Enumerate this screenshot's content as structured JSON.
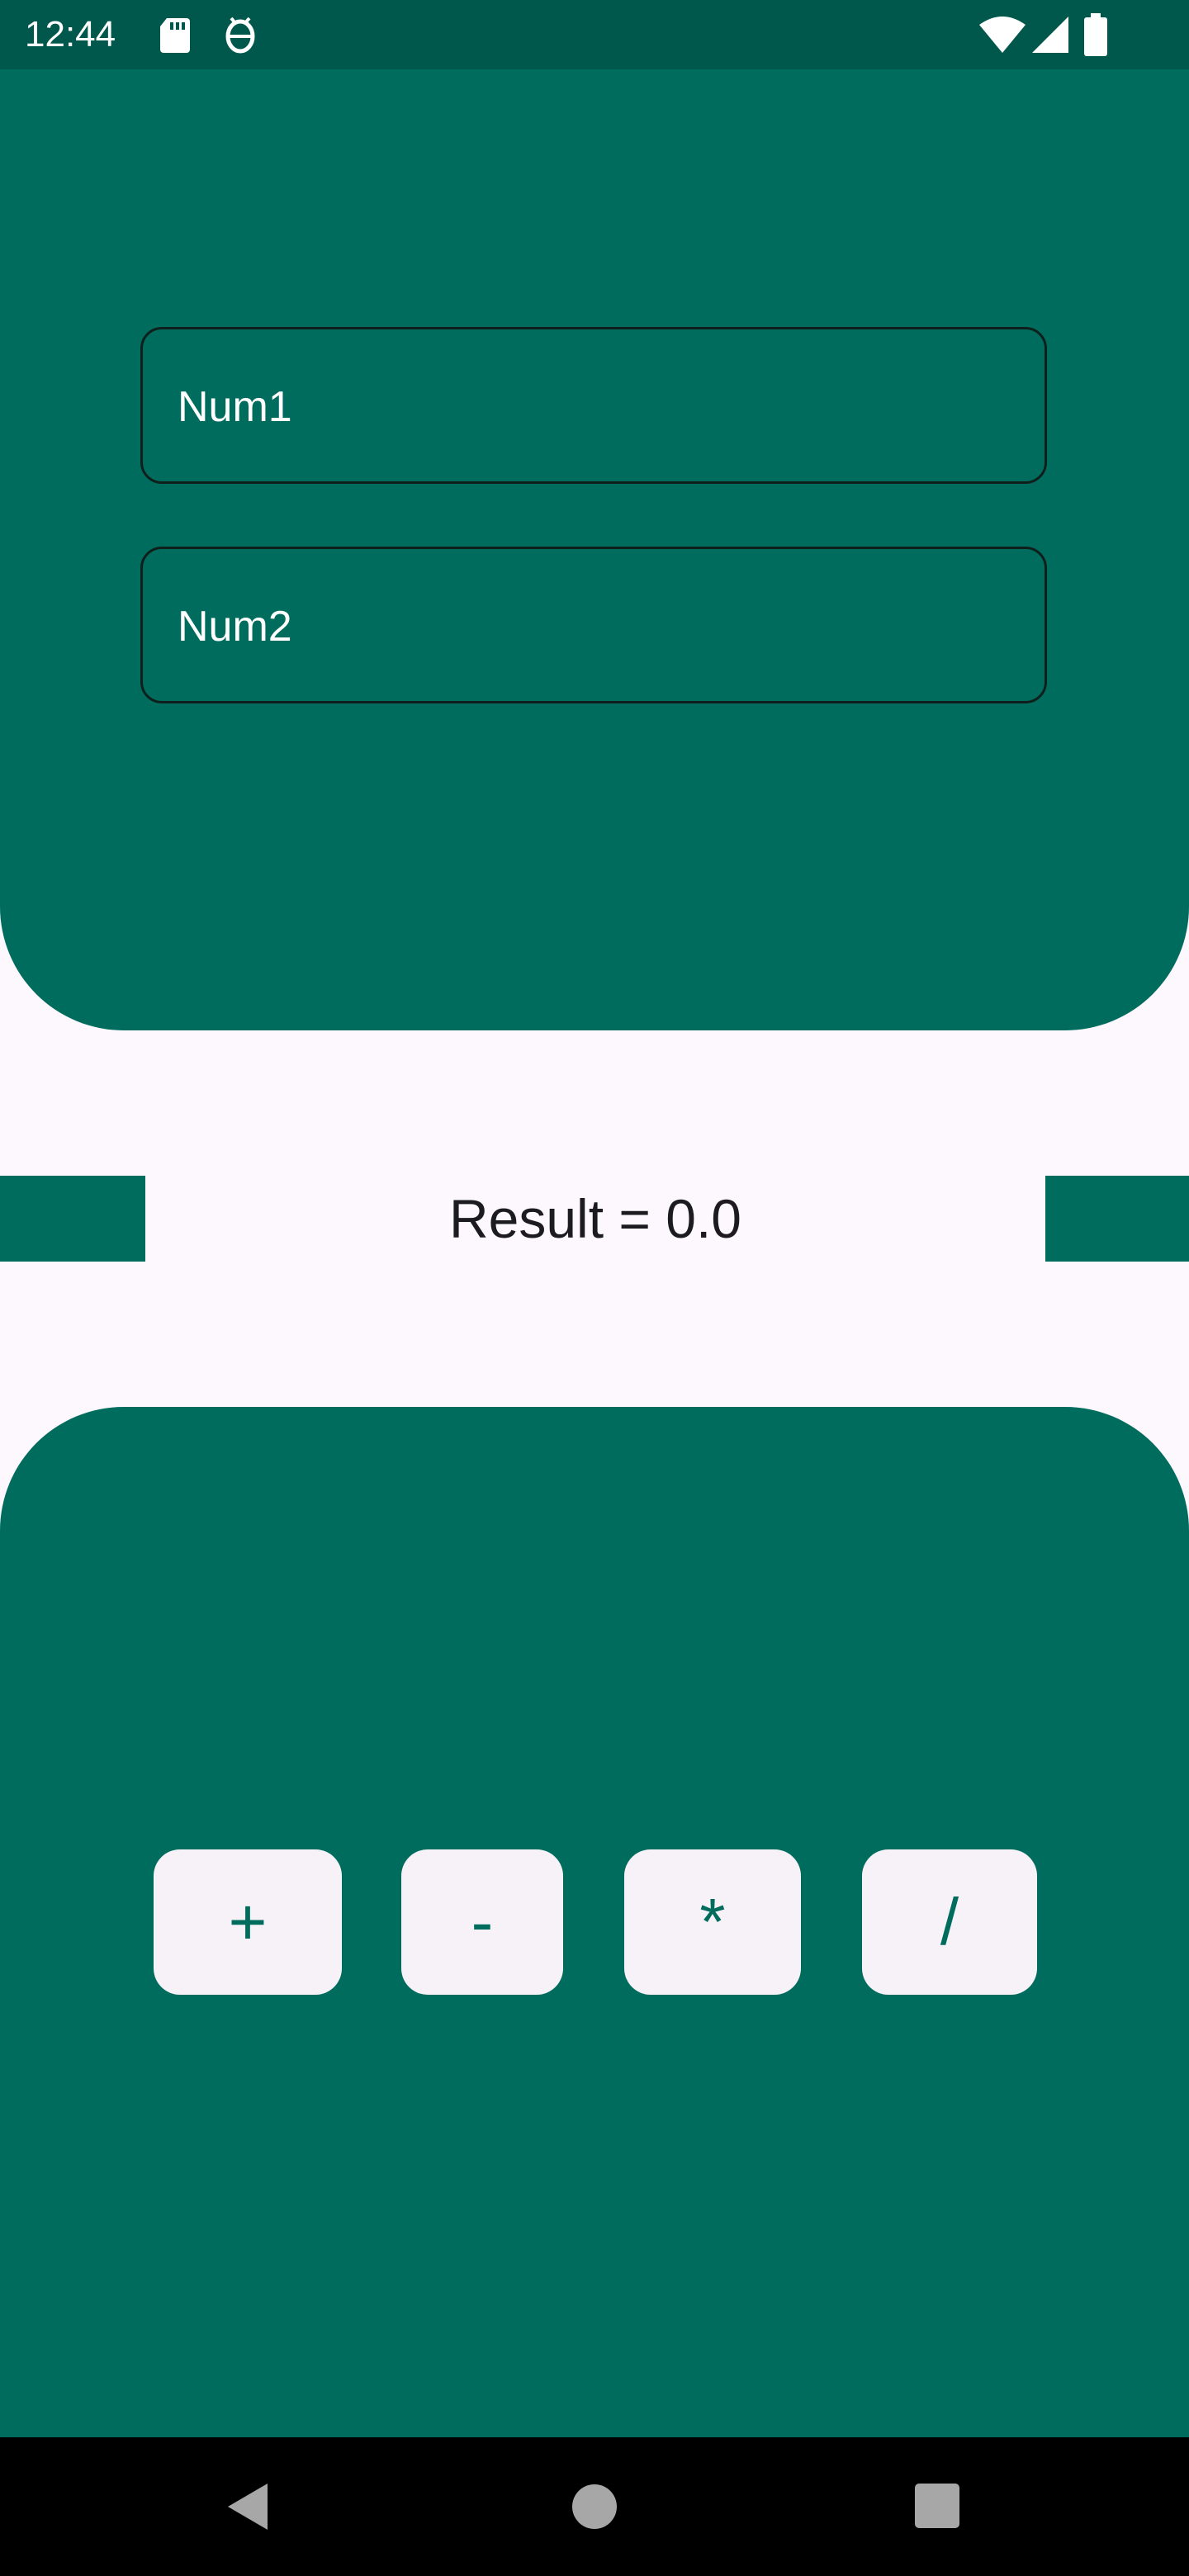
{
  "status_bar": {
    "time": "12:44",
    "icons": [
      "sd-card-icon",
      "android-debug-icon",
      "wifi-icon",
      "signal-icon",
      "battery-icon"
    ]
  },
  "inputs": {
    "num1_placeholder": "Num1",
    "num2_placeholder": "Num2"
  },
  "result": {
    "text": "Result = 0.0"
  },
  "operations": {
    "add_label": "+",
    "subtract_label": "-",
    "multiply_label": "*",
    "divide_label": "/"
  },
  "navigation": {
    "icons": [
      "back-icon",
      "home-icon",
      "recents-icon"
    ]
  },
  "colors": {
    "primary": "#006C5E",
    "status_bar": "#00574B",
    "background": "#FDF7FE",
    "button_surface": "#F6F2F7",
    "nav_bar": "#000000"
  }
}
